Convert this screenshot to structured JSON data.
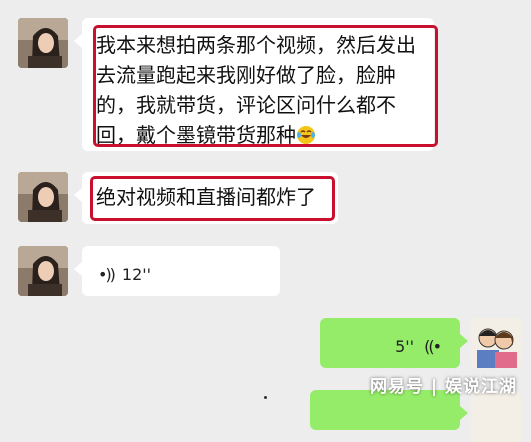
{
  "messages": [
    {
      "sender": "other",
      "type": "text",
      "lines": [
        "我本来想拍两条那个视频，然后发出",
        "去流量跑起来我刚好做了脸，脸肿",
        "的，我就带货，评论区问什么都不",
        "回，戴个墨镜带货那种"
      ],
      "emoji": "grinning-tears-emoji"
    },
    {
      "sender": "other",
      "type": "text",
      "text": "绝对视频和直播间都炸了"
    },
    {
      "sender": "other",
      "type": "voice",
      "duration": "12''"
    },
    {
      "sender": "self",
      "type": "voice",
      "duration": "5''"
    }
  ],
  "watermark": "网易号 | 娱说江湖",
  "colors": {
    "highlight": "#c8102e",
    "self_bubble": "#95ec69",
    "background": "#ededed"
  },
  "icons": [
    "avatar-other",
    "avatar-self",
    "voice-wave-icon"
  ]
}
